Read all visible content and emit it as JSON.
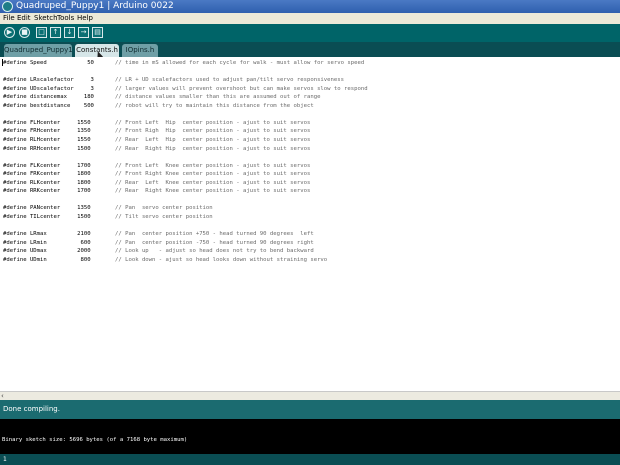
{
  "window": {
    "title": "Quadruped_Puppy1 | Arduino 0022"
  },
  "menu": [
    "File",
    "Edit",
    "Sketch",
    "Tools",
    "Help"
  ],
  "toolbar": [
    {
      "icon": "verify-icon",
      "glyph": "▶"
    },
    {
      "icon": "stop-icon",
      "glyph": "■"
    },
    {
      "icon": "new-icon",
      "glyph": "□"
    },
    {
      "icon": "open-icon",
      "glyph": "↑"
    },
    {
      "icon": "save-icon",
      "glyph": "↓"
    },
    {
      "icon": "upload-icon",
      "glyph": "→"
    },
    {
      "icon": "serial-monitor-icon",
      "glyph": "▤"
    }
  ],
  "tabs": [
    {
      "label": "Quadruped_Puppy1",
      "selected": false
    },
    {
      "label": "Constants.h",
      "selected": true
    },
    {
      "label": "IOpins.h",
      "selected": false
    }
  ],
  "code": [
    {
      "text": "#define Speed            50",
      "comment": "// time in mS allowed for each cycle for walk - must allow for servo speed"
    },
    {
      "text": "",
      "comment": ""
    },
    {
      "text": "#define LRscalefactor     3",
      "comment": "// LR + UD scalefactors used to adjust pan/tilt servo responsiveness"
    },
    {
      "text": "#define UDscalefactor     3",
      "comment": "// larger values will prevent overshoot but can make servos slow to respond"
    },
    {
      "text": "#define distancemax     180",
      "comment": "// distance values smaller than this are assumed out of range"
    },
    {
      "text": "#define bestdistance    500",
      "comment": "// robot will try to maintain this distance from the object"
    },
    {
      "text": "",
      "comment": ""
    },
    {
      "text": "#define FLHcenter     1550",
      "comment": "// Front Left  Hip  center position - ajust to suit servos"
    },
    {
      "text": "#define FRHcenter     1350",
      "comment": "// Front Righ  Hip  center position - ajust to suit servos"
    },
    {
      "text": "#define RLHcenter     1550",
      "comment": "// Rear  Left  Hip  center position - ajust to suit servos"
    },
    {
      "text": "#define RRHcenter     1500",
      "comment": "// Rear  Right Hip  center position - ajust to suit servos"
    },
    {
      "text": "",
      "comment": ""
    },
    {
      "text": "#define FLKcenter     1700",
      "comment": "// Front Left  Knee center position - ajust to suit servos"
    },
    {
      "text": "#define FRKcenter     1800",
      "comment": "// Front Right Knee center position - ajust to suit servos"
    },
    {
      "text": "#define RLKcenter     1800",
      "comment": "// Rear  Left  Knee center position - ajust to suit servos"
    },
    {
      "text": "#define RRKcenter     1700",
      "comment": "// Rear  Right Knee center position - ajust to suit servos"
    },
    {
      "text": "",
      "comment": ""
    },
    {
      "text": "#define PANcenter     1350",
      "comment": "// Pan  servo center position"
    },
    {
      "text": "#define TILcenter     1500",
      "comment": "// Tilt servo center position"
    },
    {
      "text": "",
      "comment": ""
    },
    {
      "text": "#define LRmax         2100",
      "comment": "// Pan  center position +750 - head turned 90 degrees  left"
    },
    {
      "text": "#define LRmin          600",
      "comment": "// Pan  center position -750 - head turned 90 degrees right"
    },
    {
      "text": "#define UDmax         2000",
      "comment": "// Look up   - adjust so head does not try to bend backward"
    },
    {
      "text": "#define UDmin          800",
      "comment": "// Look down - ajust so head looks down without straining servo"
    }
  ],
  "status": {
    "message": "Done compiling."
  },
  "console": {
    "output": "Binary sketch size: 5696 bytes (of a 7168 byte maximum)"
  },
  "bottom": {
    "line_number": "1"
  },
  "colors": {
    "toolbar": "#006468",
    "tabbar": "#0a4d53",
    "status": "#1b6b70",
    "console": "#000000"
  }
}
